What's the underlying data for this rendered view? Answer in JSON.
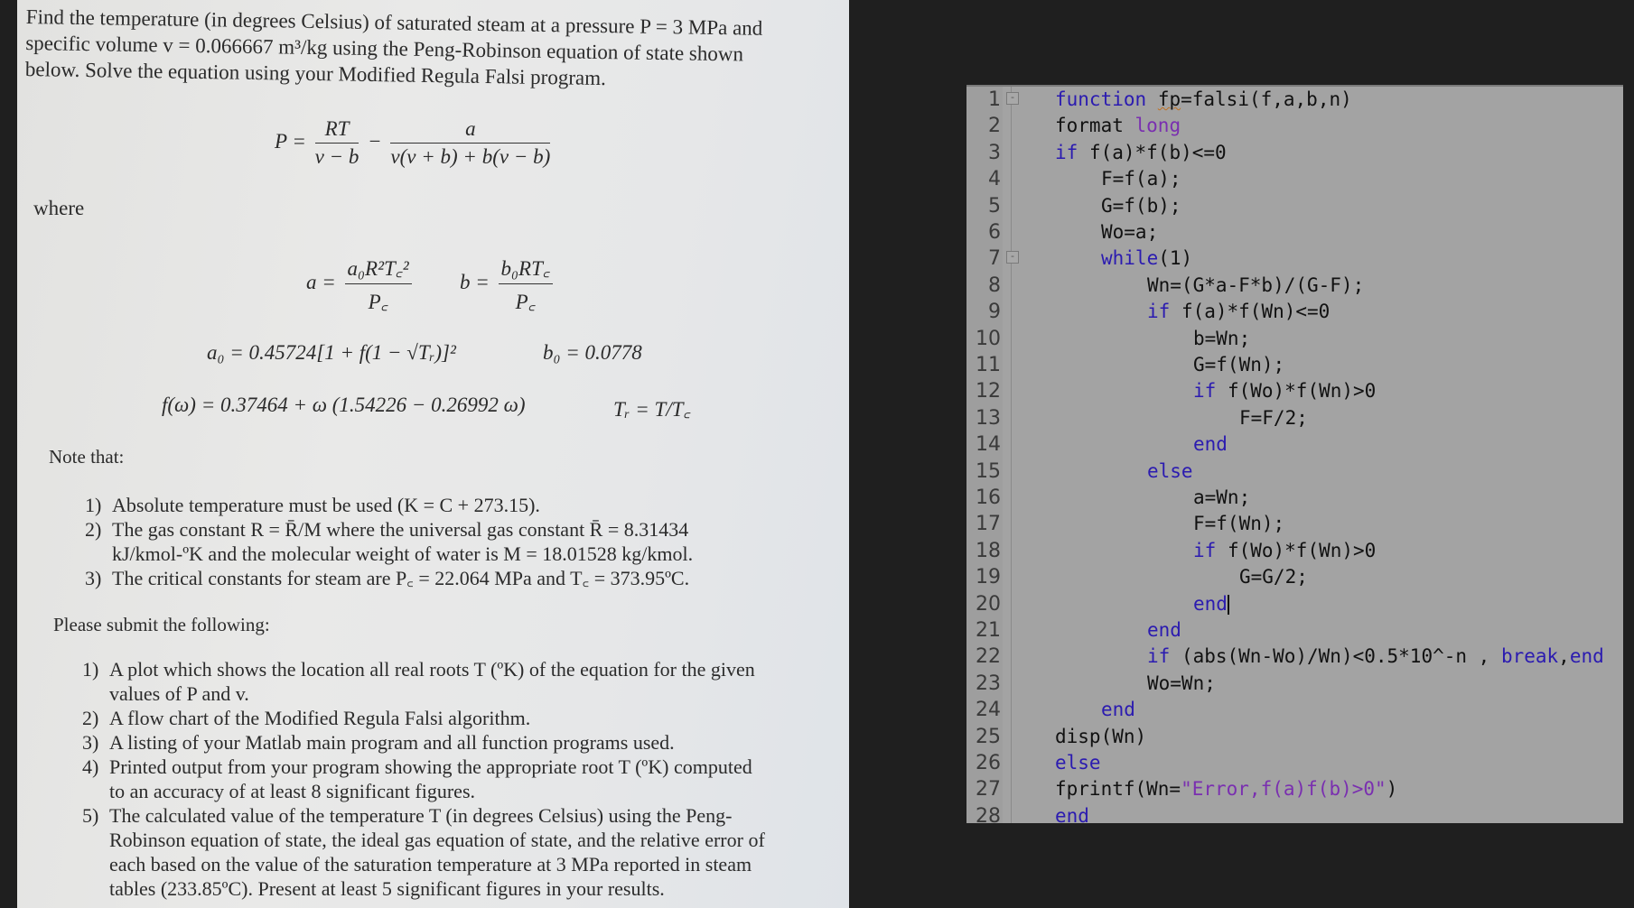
{
  "problem": {
    "intro_lines": [
      "Find the temperature (in degrees Celsius) of saturated steam at a pressure P = 3 MPa and",
      "specific volume v = 0.066667  m³/kg using the Peng-Robinson equation of state shown",
      "below.  Solve the equation using your Modified Regula Falsi program."
    ],
    "equation_main": {
      "lhs": "P =",
      "t1_num": "RT",
      "t1_den": "v − b",
      "minus": "−",
      "t2_num": "a",
      "t2_den": "v(v + b) + b(v − b)"
    },
    "where_label": "where",
    "eq_a": {
      "lhs": "a =",
      "num": "a₀R²T꜀²",
      "den": "P꜀"
    },
    "eq_b": {
      "lhs": "b =",
      "num": "b₀RT꜀",
      "den": "P꜀"
    },
    "eq_a0": "a₀ = 0.45724[1 + f(1 − √Tᵣ)]²",
    "eq_b0": "b₀ = 0.0778",
    "eq_fw": "f(ω) = 0.37464 + ω (1.54226 − 0.26992 ω)",
    "eq_tr": "Tᵣ = T/T꜀",
    "note_label": "Note that:",
    "notes": [
      {
        "n": "1)",
        "lines": [
          "Absolute temperature must be used (K = C + 273.15)."
        ]
      },
      {
        "n": "2)",
        "lines": [
          "The gas constant R = R̄/M where the universal gas constant R̄ = 8.31434",
          "kJ/kmol-ºK and the molecular weight of water is M = 18.01528 kg/kmol."
        ]
      },
      {
        "n": "3)",
        "lines": [
          "The critical constants for steam are P꜀ = 22.064 MPa and T꜀ = 373.95ºC."
        ]
      }
    ],
    "submit_label": "Please submit the following:",
    "submit_items": [
      {
        "n": "1)",
        "lines": [
          "A plot which shows the location all real roots T (ºK) of the equation for the given",
          "values of P and v."
        ]
      },
      {
        "n": "2)",
        "lines": [
          "A flow chart of the Modified Regula Falsi algorithm."
        ]
      },
      {
        "n": "3)",
        "lines": [
          "A listing of your Matlab main program and all function programs used."
        ]
      },
      {
        "n": "4)",
        "lines": [
          "Printed output from your program showing the appropriate root T (ºK) computed",
          "to an accuracy of at least 8 significant figures."
        ]
      },
      {
        "n": "5)",
        "lines": [
          "The calculated value of the temperature T (in degrees Celsius) using the Peng-",
          "Robinson equation of state, the ideal gas equation of state, and the relative error of",
          "each based on the value of the saturation temperature at 3 MPa reported in steam",
          "tables (233.85ºC).  Present at least 5 significant figures in your results."
        ]
      }
    ]
  },
  "editor": {
    "colors": {
      "keyword": "#2b1bb0",
      "string": "#7a2fb0",
      "background": "#a3a3a3"
    },
    "lines": [
      {
        "num": "1",
        "fold": "-",
        "indent": 0,
        "tokens": [
          {
            "t": "function",
            "k": "kw"
          },
          {
            "t": " "
          },
          {
            "t": "fp",
            "k": "squig"
          },
          {
            "t": "=falsi(f,a,b,n)"
          }
        ]
      },
      {
        "num": "2",
        "indent": 0,
        "tokens": [
          {
            "t": "format "
          },
          {
            "t": "long",
            "k": "str"
          }
        ]
      },
      {
        "num": "3",
        "indent": 0,
        "tokens": [
          {
            "t": "if",
            "k": "kw"
          },
          {
            "t": " f(a)*f(b)<=0"
          }
        ]
      },
      {
        "num": "4",
        "indent": 1,
        "tokens": [
          {
            "t": "F=f(a);"
          }
        ]
      },
      {
        "num": "5",
        "indent": 1,
        "tokens": [
          {
            "t": "G=f(b);"
          }
        ]
      },
      {
        "num": "6",
        "indent": 1,
        "tokens": [
          {
            "t": "Wo=a;"
          }
        ]
      },
      {
        "num": "7",
        "fold": "-",
        "indent": 1,
        "tokens": [
          {
            "t": "while",
            "k": "kw"
          },
          {
            "t": "(1)"
          }
        ]
      },
      {
        "num": "8",
        "indent": 2,
        "tokens": [
          {
            "t": "Wn=(G*a-F*b)/(G-F);"
          }
        ]
      },
      {
        "num": "9",
        "indent": 2,
        "tokens": [
          {
            "t": "if",
            "k": "kw"
          },
          {
            "t": " f(a)*f(Wn)<=0"
          }
        ]
      },
      {
        "num": "10",
        "indent": 3,
        "tokens": [
          {
            "t": "b=Wn;"
          }
        ]
      },
      {
        "num": "11",
        "indent": 3,
        "tokens": [
          {
            "t": "G=f(Wn);"
          }
        ]
      },
      {
        "num": "12",
        "indent": 3,
        "tokens": [
          {
            "t": "if",
            "k": "kw"
          },
          {
            "t": " f(Wo)*f(Wn)>0"
          }
        ]
      },
      {
        "num": "13",
        "indent": 4,
        "tokens": [
          {
            "t": "F=F/2;"
          }
        ]
      },
      {
        "num": "14",
        "indent": 3,
        "tokens": [
          {
            "t": "end",
            "k": "kw"
          }
        ]
      },
      {
        "num": "15",
        "indent": 2,
        "tokens": [
          {
            "t": "else",
            "k": "kw"
          }
        ]
      },
      {
        "num": "16",
        "indent": 3,
        "tokens": [
          {
            "t": "a=Wn;"
          }
        ]
      },
      {
        "num": "17",
        "indent": 3,
        "tokens": [
          {
            "t": "F=f(Wn);"
          }
        ]
      },
      {
        "num": "18",
        "indent": 3,
        "tokens": [
          {
            "t": "if",
            "k": "kw"
          },
          {
            "t": " f(Wo)*f(Wn)>0"
          }
        ]
      },
      {
        "num": "19",
        "indent": 4,
        "tokens": [
          {
            "t": "G=G/2;"
          }
        ]
      },
      {
        "num": "20",
        "indent": 3,
        "cursor": true,
        "tokens": [
          {
            "t": "end",
            "k": "kw"
          }
        ]
      },
      {
        "num": "21",
        "indent": 2,
        "tokens": [
          {
            "t": "end",
            "k": "kw"
          }
        ]
      },
      {
        "num": "22",
        "indent": 2,
        "tokens": [
          {
            "t": "if",
            "k": "kw"
          },
          {
            "t": " (abs(Wn-Wo)/Wn)<0.5*10^-n , "
          },
          {
            "t": "break",
            "k": "kw"
          },
          {
            "t": ","
          },
          {
            "t": "end",
            "k": "kw"
          }
        ]
      },
      {
        "num": "23",
        "indent": 2,
        "tokens": [
          {
            "t": "Wo=Wn;"
          }
        ]
      },
      {
        "num": "24",
        "indent": 1,
        "tokens": [
          {
            "t": "end",
            "k": "kw"
          }
        ]
      },
      {
        "num": "25",
        "indent": 0,
        "tokens": [
          {
            "t": "disp(Wn)"
          }
        ]
      },
      {
        "num": "26",
        "indent": 0,
        "tokens": [
          {
            "t": "else",
            "k": "kw"
          }
        ]
      },
      {
        "num": "27",
        "indent": 0,
        "tokens": [
          {
            "t": "fprintf(Wn="
          },
          {
            "t": "\"Error,f(a)f(b)>0\"",
            "k": "str"
          },
          {
            "t": ")"
          }
        ]
      },
      {
        "num": "28",
        "indent": 0,
        "tokens": [
          {
            "t": "end",
            "k": "kw"
          }
        ]
      }
    ]
  }
}
